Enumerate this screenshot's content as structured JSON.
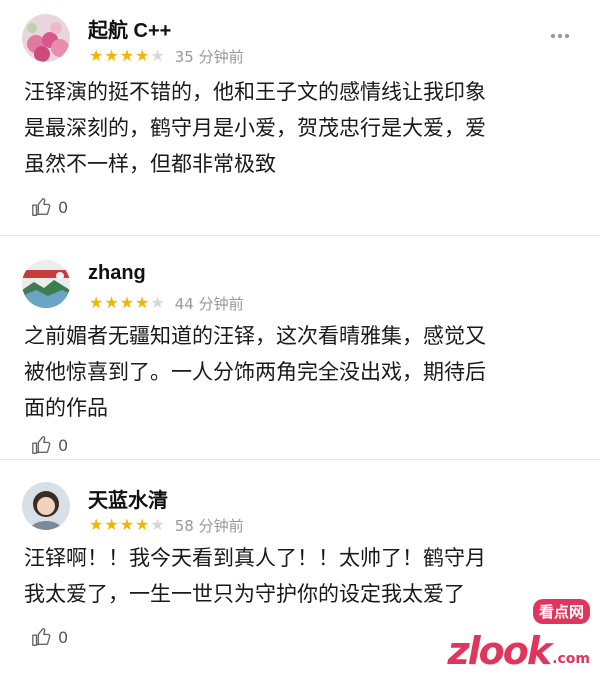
{
  "comments": [
    {
      "username": "起航 C++",
      "rating": 4,
      "max_rating": 5,
      "time": "35 分钟前",
      "text_lines": [
        "汪铎演的挺不错的，他和王子文的感情线让我印象",
        "是最深刻的，鹤守月是小爱，贺茂忠行是大爱，爱",
        "虽然不一样，但都非常极致"
      ],
      "likes": "0",
      "avatar_icon": "flower-avatar"
    },
    {
      "username": "zhang",
      "rating": 4,
      "max_rating": 5,
      "time": "44 分钟前",
      "text_lines": [
        "之前媚者无疆知道的汪铎，这次看晴雅集，感觉又",
        "被他惊喜到了。一人分饰两角完全没出戏，期待后",
        "面的作品"
      ],
      "likes": "0",
      "avatar_icon": "landscape-avatar"
    },
    {
      "username": "天蓝水清",
      "rating": 4,
      "max_rating": 5,
      "time": "58 分钟前",
      "text_lines": [
        "汪铎啊！！我今天看到真人了！！太帅了！鹤守月",
        "我太爱了，一生一世只为守护你的设定我太爱了"
      ],
      "likes": "0",
      "avatar_icon": "portrait-avatar"
    }
  ],
  "watermark": {
    "main": "zlook",
    "badge": "看点网",
    "suffix": ".com"
  },
  "colors": {
    "star_on": "#f4b400",
    "star_off": "#d8d8d8",
    "time": "#999999",
    "watermark": "#e0355c"
  }
}
